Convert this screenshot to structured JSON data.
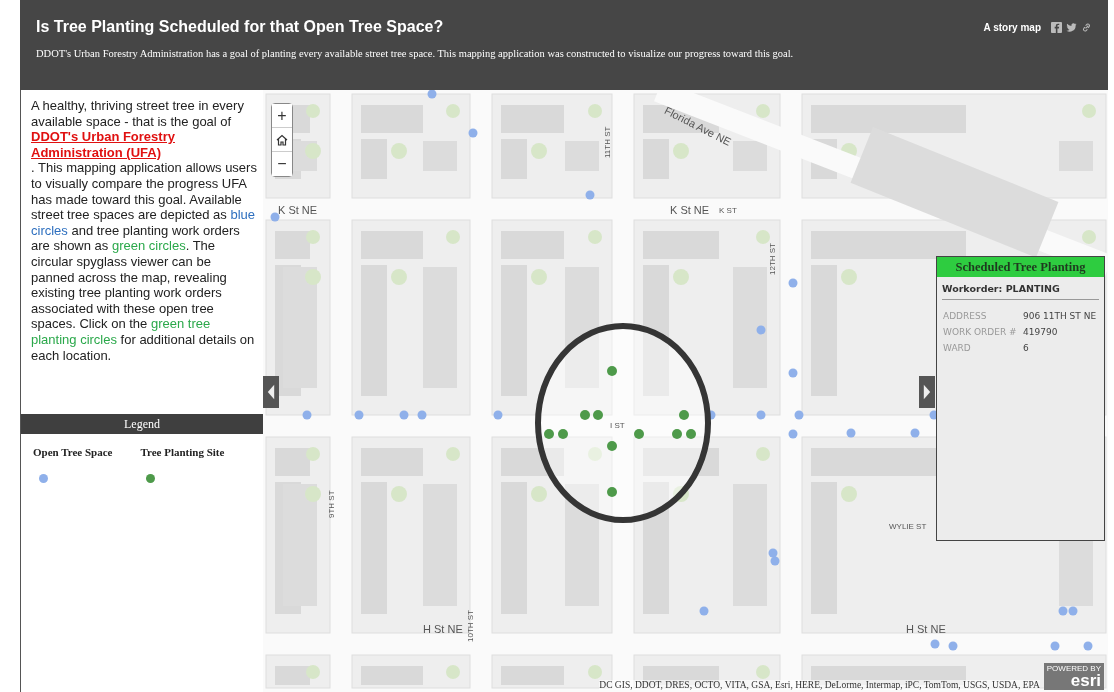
{
  "header": {
    "title": "Is Tree Planting Scheduled for that Open Tree Space?",
    "subtitle": "DDOT's Urban Forestry Administration has a goal of planting every available street tree space. This mapping application was constructed to visualize our progress toward this goal.",
    "story_map_link": "A story map"
  },
  "intro": [
    {
      "kind": "plain",
      "text": "A healthy, thriving street tree in every available space - that is the goal of "
    },
    {
      "kind": "link",
      "text": "DDOT's Urban Forestry Administration (UFA)"
    },
    {
      "kind": "plain",
      "text": ".  This mapping application allows users to visually compare the progress UFA has made toward this goal. Available street tree spaces are depicted as "
    },
    {
      "kind": "blue",
      "text": "blue circles"
    },
    {
      "kind": "plain",
      "text": " and tree planting work orders are shown as "
    },
    {
      "kind": "green",
      "text": "green circles"
    },
    {
      "kind": "plain",
      "text": ".  The circular spyglass viewer can be panned across the map, revealing existing tree planting work orders associated with these open tree spaces. Click on the "
    },
    {
      "kind": "green",
      "text": "green tree planting circles"
    },
    {
      "kind": "plain",
      "text": " for additional details on each location."
    }
  ],
  "legend": {
    "title": "Legend",
    "items": [
      {
        "label": "Open Tree Space",
        "color": "#8fb0ea"
      },
      {
        "label": "Tree Planting Site",
        "color": "#4e9a4a"
      }
    ]
  },
  "map": {
    "zoom_buttons": [
      "+",
      "−"
    ],
    "street_labels": [
      "K St NE",
      "K St NE",
      "K ST",
      "11TH ST",
      "12TH ST",
      "Florida Ave NE",
      "I ST",
      "9TH ST",
      "10TH ST",
      "H St NE",
      "H St NE",
      "WYLIE ST"
    ],
    "popup": {
      "title": "Scheduled Tree Planting",
      "subtitle": "Workorder: PLANTING",
      "rows": [
        {
          "label": "ADDRESS",
          "value": "906 11TH ST NE"
        },
        {
          "label": "WORK ORDER #",
          "value": "419790"
        },
        {
          "label": "WARD",
          "value": "6"
        }
      ]
    },
    "attribution": "DC GIS, DDOT, DRES, OCTO, VITA, GSA, Esri, HERE, DeLorme, Intermap, iPC, TomTom, USGS, USDA, EPA",
    "logo_caption": "POWERED BY",
    "logo": "esri"
  }
}
